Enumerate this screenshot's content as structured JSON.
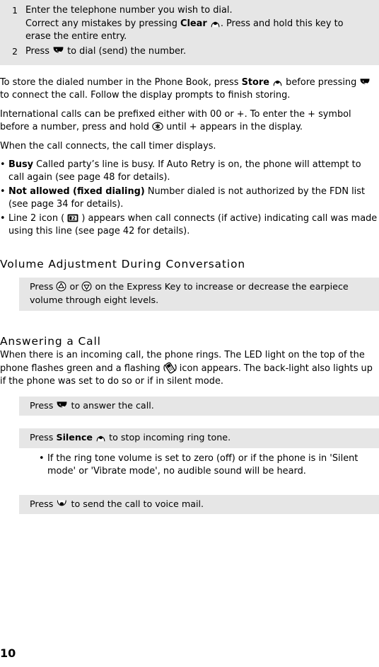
{
  "document": {
    "page_number": "10"
  },
  "steps": [
    {
      "number": "1",
      "line1": "Enter the telephone number you wish to dial.",
      "line2_pre": "Correct any mistakes by pressing ",
      "line2_bold": "Clear",
      "line2_icon": "clear-softkey-icon",
      "line2_post": ". Press and hold this key to erase the entire entry."
    },
    {
      "number": "2",
      "pre": "Press ",
      "icon": "send-key-icon",
      "post": " to dial (send) the number."
    }
  ],
  "paragraphs": {
    "store": {
      "part1": "To store the dialed number in the Phone Book, press ",
      "bold": "Store",
      "icon1": "store-softkey-icon",
      "part2": " before pressing ",
      "icon2": "send-key-icon",
      "part3": " to connect the call. Follow the display prompts to finish storing."
    },
    "international": {
      "part1": "International calls can be prefixed either with 00 or +. To enter the + symbol before a number, press and hold ",
      "icon": "asterisk-key-icon",
      "part2": " until + appears in the display."
    },
    "timer": "When the call connects, the call timer displays."
  },
  "bullets": [
    {
      "bold": "Busy",
      "text": " Called party’s line is busy. If Auto Retry is on, the phone will attempt to call again (see page 48 for details)."
    },
    {
      "bold": "Not allowed (fixed dialing)",
      "text": " Number dialed is not authorized by the FDN list (see page 34 for details)."
    },
    {
      "bold": "",
      "pre": "Line 2 icon ( ",
      "icon": "line2-indicator-icon",
      "post": " ) appears when call connects (if active) indicating call was made using this line (see page 42 for details)."
    }
  ],
  "sections": {
    "volume": {
      "heading": "Volume Adjustment During Conversation",
      "band": {
        "pre": "Press ",
        "icon_up": "volume-up-key-icon",
        "mid": " or ",
        "icon_down": "volume-down-key-icon",
        "post": " on the Express Key to increase or decrease the earpiece volume through eight levels."
      }
    },
    "answering": {
      "heading": "Answering a Call",
      "intro_part1": "When there is an incoming call, the phone rings. The LED light on the top of the phone flashes green and a flashing ",
      "intro_icon": "incoming-call-icon",
      "intro_part2": " icon appears. The back-light also lights up if the phone was set to do so or if in silent mode.",
      "band_answer": {
        "pre": "Press ",
        "icon": "send-key-icon",
        "post": " to answer the call."
      },
      "band_silence": {
        "pre": "Press ",
        "bold": "Silence",
        "icon": "silence-softkey-icon",
        "post": " to stop incoming ring tone."
      },
      "sub_bullet": "If the ring tone volume is set to zero (off) or if the phone is in 'Silent mode' or 'Vibrate mode', no audible sound will be heard.",
      "band_voicemail": {
        "pre": "Press ",
        "icon": "voicemail-softkey-icon",
        "post": " to send the call to voice mail."
      }
    }
  },
  "colors": {
    "band_background": "#e6e6e6",
    "text": "#000000",
    "page_background": "#ffffff"
  }
}
